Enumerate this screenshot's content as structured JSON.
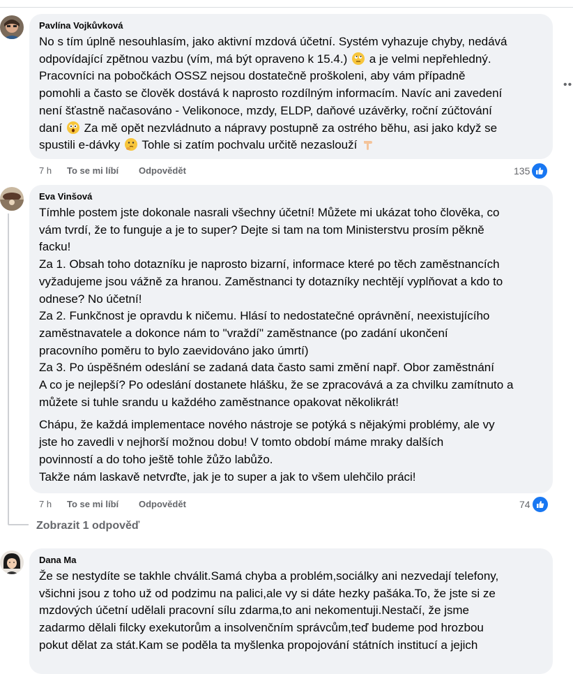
{
  "comments": [
    {
      "author": "Pavlína Vojkůvková",
      "lines": [
        "No s tím úplně nesouhlasím, jako aktivní mzdová účetní. Systém vyhazuje chyby, nedává",
        "odpovídající zpětnou vazbu (vím, má být opraveno k 15.4.)",
        "a je velmi nepřehledný.",
        "Pracovníci na pobočkách OSSZ nejsou dostatečně proškoleni, aby vám případně",
        "pomohli a často se člověk dostává k naprosto rozdílným informacím. Navíc ani zavedení",
        "není šťastně načasováno - Velikonoce, mzdy, ELDP, daňové uzávěrky, roční zúčtování",
        "daní",
        "Za mě opět nezvládnuto a nápravy postupně za ostrého běhu, asi jako když se",
        "spustili e-dávky",
        "Tohle si zatím pochvalu určitě nezaslouží"
      ],
      "time": "7 h",
      "like_label": "To se mi líbí",
      "reply_label": "Odpovědět",
      "reaction_count": "135"
    },
    {
      "author": "Eva Vinšová",
      "lines": [
        "Tímhle postem jste dokonale nasrali všechny účetní! Můžete mi ukázat toho člověka, co",
        "vám tvrdí, že to funguje a je to super? Dejte si tam na tom Ministerstvu prosím pěkně",
        "facku!",
        "Za 1. Obsah toho dotazníku je naprosto bizarní, informace které po těch zaměstnancích",
        "vyžadujeme jsou vážně za hranou. Zaměstnanci ty dotazníky nechtějí vyplňovat a kdo to",
        "odnese? No účetní!",
        "Za 2. Funkčnost je opravdu k ničemu. Hlásí to nedostatečné oprávnění, neexistujícího",
        "zaměstnavatele a dokonce nám to \"vraždí\" zaměstnance (po zadání ukončení",
        "pracovního poměru to bylo zaevidováno jako úmrtí)",
        "Za 3. Po úspěšném odeslání se zadaná data často sami změní např. Obor zaměstnání",
        "A co je nejlepší? Po odeslání dostanete hlášku, že se zpracovává a za chvilku zamítnuto a",
        "můžete si tuhle srandu u každého zaměstnance opakovat několikrát!",
        "Chápu, že každá implementace nového nástroje se potýká s nějakými problémy, ale vy",
        "jste ho zavedli v nejhorší možnou dobu! V tomto období máme mraky dalších",
        "povinností a do toho ještě tohle žůžo labůžo.",
        "Takže nám laskavě netvrďte, jak je to super a jak to všem ulehčilo práci!"
      ],
      "time": "7 h",
      "like_label": "To se mi líbí",
      "reply_label": "Odpovědět",
      "reaction_count": "74",
      "show_replies": "Zobrazit 1 odpověď"
    },
    {
      "author": "Dana Ma",
      "lines": [
        "Že se nestydíte se takhle chválit.Samá chyba a problém,sociálky ani nezvedají telefony,",
        "všichni jsou z toho už od podzimu na palici,ale vy si dáte hezky pašáka.To, že jste si ze",
        "mzdových účetní udělali pracovní sílu zdarma,to ani nekomentuji.Nestačí, že jsme",
        "zadarmo dělali filcky exekutorům a insolvenčním správcům,teď budeme pod hrozbou",
        "pokut dělat za stát.Kam se poděla ta myšlenka propojování státních institucí a jejich"
      ]
    }
  ],
  "icons": {
    "more": "more-options-icon",
    "like": "like-reaction-icon"
  },
  "colors": {
    "bubble": "#f0f2f5",
    "meta": "#65676b",
    "like_blue": "#1877f2"
  }
}
